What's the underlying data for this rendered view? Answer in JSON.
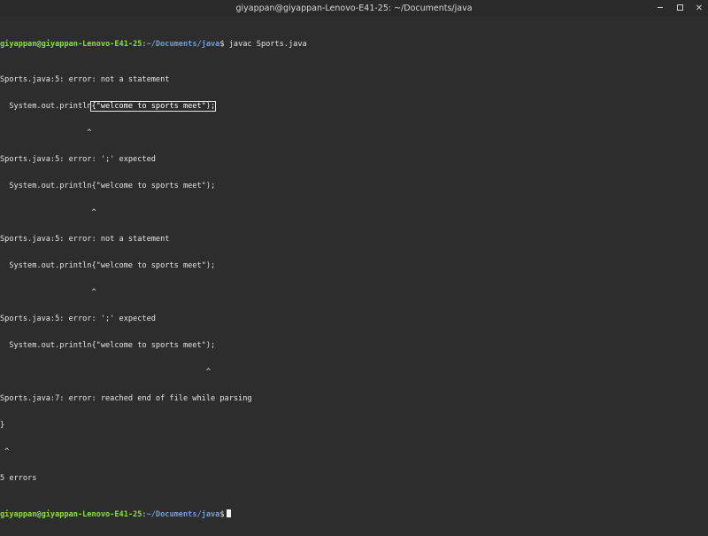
{
  "window": {
    "title": "giyappan@giyappan-Lenovo-E41-25: ~/Documents/java",
    "controls": {
      "minimize_icon": "minimize-icon",
      "maximize_icon": "maximize-icon",
      "close_label": "✕"
    }
  },
  "terminal": {
    "prompt1": {
      "user": "giyappan@giyappan-Lenovo-E41-25",
      "sep": ":",
      "path": "~/Documents/java",
      "dollar": "$",
      "command": " javac Sports.java"
    },
    "lines": [
      "Sports.java:5: error: not a statement",
      "  System.out.println",
      "\"welcome to sports meet\");",
      "                   ^",
      "Sports.java:5: error: ';' expected",
      "  System.out.println{\"welcome to sports meet\");",
      "                    ^",
      "Sports.java:5: error: not a statement",
      "  System.out.println{\"welcome to sports meet\");",
      "                    ^",
      "Sports.java:5: error: ';' expected",
      "  System.out.println{\"welcome to sports meet\");",
      "                                             ^",
      "Sports.java:7: error: reached end of file while parsing",
      "}",
      " ^",
      "5 errors"
    ],
    "selected_text": "{\"welcome to sports meet\");",
    "prompt2": {
      "user": "giyappan@giyappan-Lenovo-E41-25",
      "sep": ":",
      "path": "~/Documents/java",
      "dollar": "$"
    }
  },
  "colors": {
    "background": "#2d2d2d",
    "prompt_user": "#8ae234",
    "prompt_path": "#729fcf",
    "text": "#e4e4e4"
  }
}
